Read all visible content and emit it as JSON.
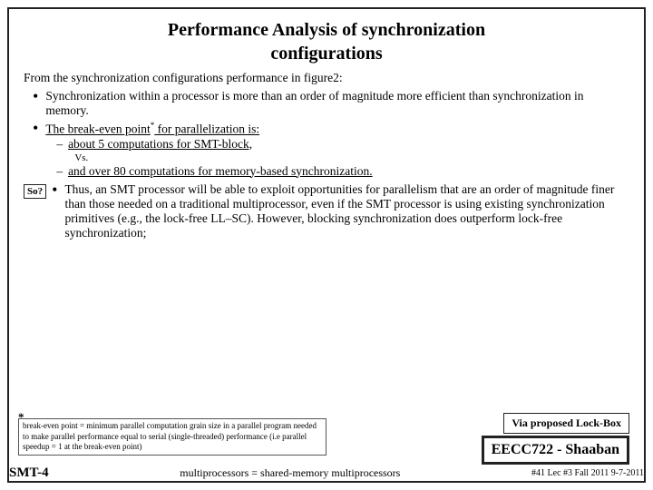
{
  "title": {
    "line1": "Performance Analysis of synchronization",
    "line2": "configurations"
  },
  "intro": "From the synchronization configurations performance in figure2:",
  "bullets": [
    {
      "id": "b1",
      "text": "Synchronization within a processor is more than an order of magnitude more efficient than synchronization in memory."
    },
    {
      "id": "b2",
      "label": "The break-even point",
      "star": "*",
      "suffix": "for parallelization is:",
      "sub": [
        {
          "dash": "–",
          "text": "about 5 computations for SMT-block,"
        },
        {
          "vs": "Vs."
        },
        {
          "dash": "–",
          "text": "and over 80 computations for memory-based synchronization."
        }
      ]
    }
  ],
  "so_badge": "So?",
  "so_bullet": "•",
  "so_text": "Thus, an SMT processor will be able to exploit opportunities for parallelism that are an order of magnitude finer than those needed on a traditional multiprocessor, even if the SMT processor is using existing synchronization primitives (e.g., the lock-free LL–SC). However, blocking synchronization does outperform lock-free synchronization;",
  "star_label": "*",
  "footnote": "break-even point = minimum parallel computation grain size in a parallel program needed to make parallel performance equal to serial (single-threaded) performance (i.e parallel speedup = 1 at the break-even point)",
  "via_box": "Via proposed Lock-Box",
  "eecc_box": "EECC722 - Shaaban",
  "bottom": {
    "left": "SMT-4",
    "center": "multiprocessors = shared-memory multiprocessors",
    "right": "#41  Lec #3  Fall 2011  9-7-2011"
  }
}
